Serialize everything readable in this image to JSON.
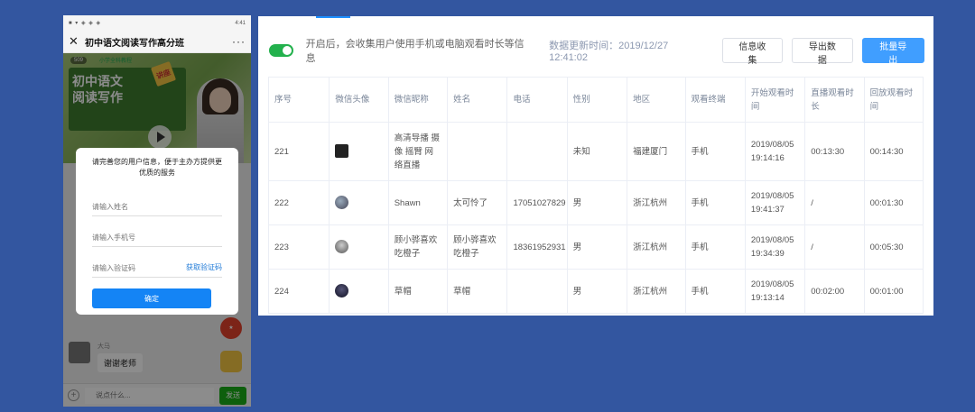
{
  "phone": {
    "status_left": "■ ▾ ◈ ◈ ◈",
    "status_right": "4:41",
    "title": "初中语文阅读写作高分班",
    "close_glyph": "✕",
    "more_glyph": "···",
    "video": {
      "viewer_count": "509",
      "badge": "小学全科教程",
      "banner_line1": "初中语文",
      "banner_line2": "阅读写作",
      "banner_tag": "讲座"
    },
    "modal": {
      "title": "请完善您的用户信息，便于主办方提供更优质的服务",
      "name_placeholder": "请输入姓名",
      "phone_placeholder": "请输入手机号",
      "code_placeholder": "请输入验证码",
      "get_code": "获取验证码",
      "confirm": "确定"
    },
    "chat": {
      "username": "大马",
      "message": "谢谢老师"
    },
    "input_placeholder": "说点什么...",
    "send": "发送"
  },
  "panel": {
    "hint": "开启后，会收集用户使用手机或电脑观看时长等信息",
    "update_time": "数据更新时间：2019/12/27 12:41:02",
    "buttons": {
      "collect": "信息收集",
      "export": "导出数据",
      "batch_export": "批量导出"
    },
    "toggle_on": true,
    "columns": [
      "序号",
      "微信头像",
      "微信昵称",
      "姓名",
      "电话",
      "性别",
      "地区",
      "观看终端",
      "开始观看时间",
      "直播观看时长",
      "回放观看时间"
    ],
    "rows": [
      {
        "id": "221",
        "nickname": "高清导播 摄像 摇臂 网络直播",
        "name": "",
        "phone": "",
        "gender": "未知",
        "region": "福建厦门",
        "terminal": "手机",
        "start": "2019/08/05 19:14:16",
        "live": "00:13:30",
        "replay": "00:14:30"
      },
      {
        "id": "222",
        "nickname": "Shawn",
        "name": "太可怜了",
        "phone": "17051027829",
        "gender": "男",
        "region": "浙江杭州",
        "terminal": "手机",
        "start": "2019/08/05 19:41:37",
        "live": "/",
        "replay": "00:01:30"
      },
      {
        "id": "223",
        "nickname": "顾小骅喜欢吃橙子",
        "name": "顾小骅喜欢吃橙子",
        "phone": "18361952931",
        "gender": "男",
        "region": "浙江杭州",
        "terminal": "手机",
        "start": "2019/08/05 19:34:39",
        "live": "/",
        "replay": "00:05:30"
      },
      {
        "id": "224",
        "nickname": "草帽",
        "name": "草帽",
        "phone": "",
        "gender": "男",
        "region": "浙江杭州",
        "terminal": "手机",
        "start": "2019/08/05 19:13:14",
        "live": "00:02:00",
        "replay": "00:01:00"
      }
    ]
  },
  "colors": {
    "background": "#3356a0",
    "primary": "#409eff",
    "toggle": "#23b14d",
    "send": "#1aad19"
  }
}
